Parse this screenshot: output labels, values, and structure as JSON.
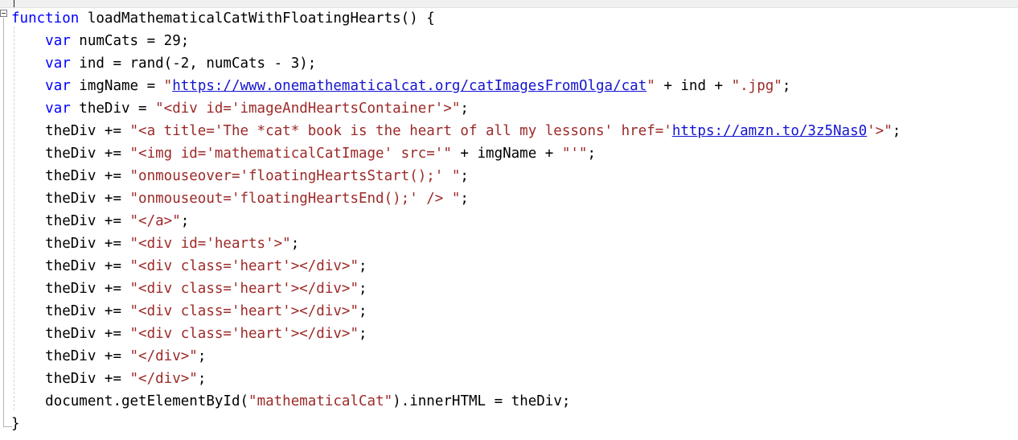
{
  "editor": {
    "app_kind": "code-editor",
    "language": "javascript",
    "gutter": {
      "fold_marker": "-",
      "fold_state": "expanded"
    },
    "colors": {
      "background": "#ffffff",
      "text": "#000000",
      "keyword": "#0000ff",
      "string": "#9c2a28",
      "link": "#1414d2",
      "gutter_line": "#b4b4b4",
      "indent_guide": "#d2d2d2",
      "top_strip": "#f0f0f0"
    },
    "lines": [
      {
        "indent": 0,
        "tokens": [
          {
            "t": "kw",
            "s": "function"
          },
          {
            "t": "plain",
            "s": " loadMathematicalCatWithFloatingHearts() {"
          }
        ]
      },
      {
        "indent": 1,
        "tokens": [
          {
            "t": "kw",
            "s": "var"
          },
          {
            "t": "plain",
            "s": " numCats = 29;"
          }
        ]
      },
      {
        "indent": 1,
        "tokens": [
          {
            "t": "kw",
            "s": "var"
          },
          {
            "t": "plain",
            "s": " ind = rand(-2, numCats - 3);"
          }
        ]
      },
      {
        "indent": 1,
        "tokens": [
          {
            "t": "kw",
            "s": "var"
          },
          {
            "t": "plain",
            "s": " imgName = "
          },
          {
            "t": "str",
            "s": "\""
          },
          {
            "t": "lnk",
            "s": "https://www.onemathematicalcat.org/catImagesFromOlga/cat"
          },
          {
            "t": "str",
            "s": "\""
          },
          {
            "t": "plain",
            "s": " + ind + "
          },
          {
            "t": "str",
            "s": "\".jpg\""
          },
          {
            "t": "plain",
            "s": ";"
          }
        ]
      },
      {
        "indent": 1,
        "tokens": [
          {
            "t": "kw",
            "s": "var"
          },
          {
            "t": "plain",
            "s": " theDiv = "
          },
          {
            "t": "str",
            "s": "\"<div id='imageAndHeartsContainer'>\""
          },
          {
            "t": "plain",
            "s": ";"
          }
        ]
      },
      {
        "indent": 1,
        "tokens": [
          {
            "t": "plain",
            "s": "theDiv += "
          },
          {
            "t": "str",
            "s": "\"<a title='The *cat* book is the heart of all my lessons' href='"
          },
          {
            "t": "lnk",
            "s": "https://amzn.to/3z5Nas0"
          },
          {
            "t": "str",
            "s": "'>\""
          },
          {
            "t": "plain",
            "s": ";"
          }
        ]
      },
      {
        "indent": 1,
        "tokens": [
          {
            "t": "plain",
            "s": "theDiv += "
          },
          {
            "t": "str",
            "s": "\"<img id='mathematicalCatImage' src='\""
          },
          {
            "t": "plain",
            "s": " + imgName + "
          },
          {
            "t": "str",
            "s": "\"'\""
          },
          {
            "t": "plain",
            "s": ";"
          }
        ]
      },
      {
        "indent": 1,
        "tokens": [
          {
            "t": "plain",
            "s": "theDiv += "
          },
          {
            "t": "str",
            "s": "\"onmouseover='floatingHeartsStart();' \""
          },
          {
            "t": "plain",
            "s": ";"
          }
        ]
      },
      {
        "indent": 1,
        "tokens": [
          {
            "t": "plain",
            "s": "theDiv += "
          },
          {
            "t": "str",
            "s": "\"onmouseout='floatingHeartsEnd();' /> \""
          },
          {
            "t": "plain",
            "s": ";"
          }
        ]
      },
      {
        "indent": 1,
        "tokens": [
          {
            "t": "plain",
            "s": "theDiv += "
          },
          {
            "t": "str",
            "s": "\"</a>\""
          },
          {
            "t": "plain",
            "s": ";"
          }
        ]
      },
      {
        "indent": 1,
        "tokens": [
          {
            "t": "plain",
            "s": "theDiv += "
          },
          {
            "t": "str",
            "s": "\"<div id='hearts'>\""
          },
          {
            "t": "plain",
            "s": ";"
          }
        ]
      },
      {
        "indent": 1,
        "tokens": [
          {
            "t": "plain",
            "s": "theDiv += "
          },
          {
            "t": "str",
            "s": "\"<div class='heart'></div>\""
          },
          {
            "t": "plain",
            "s": ";"
          }
        ]
      },
      {
        "indent": 1,
        "tokens": [
          {
            "t": "plain",
            "s": "theDiv += "
          },
          {
            "t": "str",
            "s": "\"<div class='heart'></div>\""
          },
          {
            "t": "plain",
            "s": ";"
          }
        ]
      },
      {
        "indent": 1,
        "tokens": [
          {
            "t": "plain",
            "s": "theDiv += "
          },
          {
            "t": "str",
            "s": "\"<div class='heart'></div>\""
          },
          {
            "t": "plain",
            "s": ";"
          }
        ]
      },
      {
        "indent": 1,
        "tokens": [
          {
            "t": "plain",
            "s": "theDiv += "
          },
          {
            "t": "str",
            "s": "\"<div class='heart'></div>\""
          },
          {
            "t": "plain",
            "s": ";"
          }
        ]
      },
      {
        "indent": 1,
        "tokens": [
          {
            "t": "plain",
            "s": "theDiv += "
          },
          {
            "t": "str",
            "s": "\"</div>\""
          },
          {
            "t": "plain",
            "s": ";"
          }
        ]
      },
      {
        "indent": 1,
        "tokens": [
          {
            "t": "plain",
            "s": "theDiv += "
          },
          {
            "t": "str",
            "s": "\"</div>\""
          },
          {
            "t": "plain",
            "s": ";"
          }
        ]
      },
      {
        "indent": 1,
        "tokens": [
          {
            "t": "plain",
            "s": "document.getElementById("
          },
          {
            "t": "str",
            "s": "\"mathematicalCat\""
          },
          {
            "t": "plain",
            "s": ").innerHTML = theDiv;"
          }
        ]
      },
      {
        "indent": 0,
        "tokens": [
          {
            "t": "plain",
            "s": "}"
          }
        ]
      }
    ]
  }
}
